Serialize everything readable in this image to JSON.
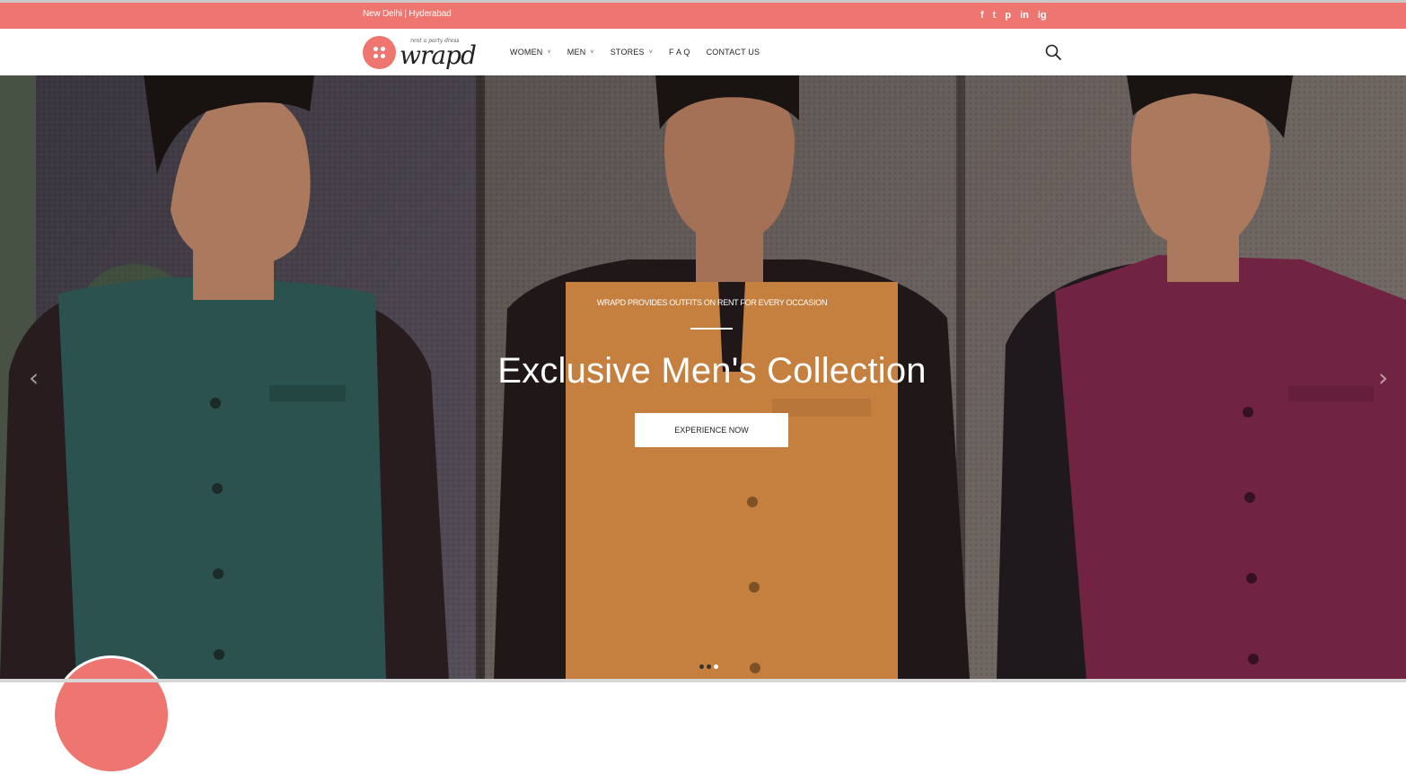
{
  "topbar": {
    "locations": "New Delhi | Hyderabad",
    "social_icons": [
      "facebook-icon",
      "twitter-icon",
      "pinterest-icon",
      "linkedin-icon",
      "instagram-icon"
    ],
    "social_glyphs": [
      "f",
      "t",
      "p",
      "in",
      "ig"
    ],
    "background_color": "#ef7670"
  },
  "logo": {
    "tagline": "rent a party dress",
    "wordmark": "wrapd"
  },
  "nav": {
    "items": [
      {
        "label": "WOMEN",
        "has_dropdown": true
      },
      {
        "label": "MEN",
        "has_dropdown": true
      },
      {
        "label": "STORES",
        "has_dropdown": true
      },
      {
        "label": "F A Q",
        "has_dropdown": false
      },
      {
        "label": "CONTACT US",
        "has_dropdown": false
      }
    ],
    "dropdown_glyph": "˅"
  },
  "hero": {
    "subtitle": "WRAPD PROVIDES OUTFITS ON RENT FOR EVERY OCCASION",
    "headline": "Exclusive Men's Collection",
    "cta_label": "EXPERIENCE NOW",
    "prev_glyph": "‹",
    "next_glyph": "›",
    "slides_count": 3,
    "active_slide": 3,
    "vest_colors": [
      "#2e5652",
      "#d98f45",
      "#7a2645"
    ]
  }
}
